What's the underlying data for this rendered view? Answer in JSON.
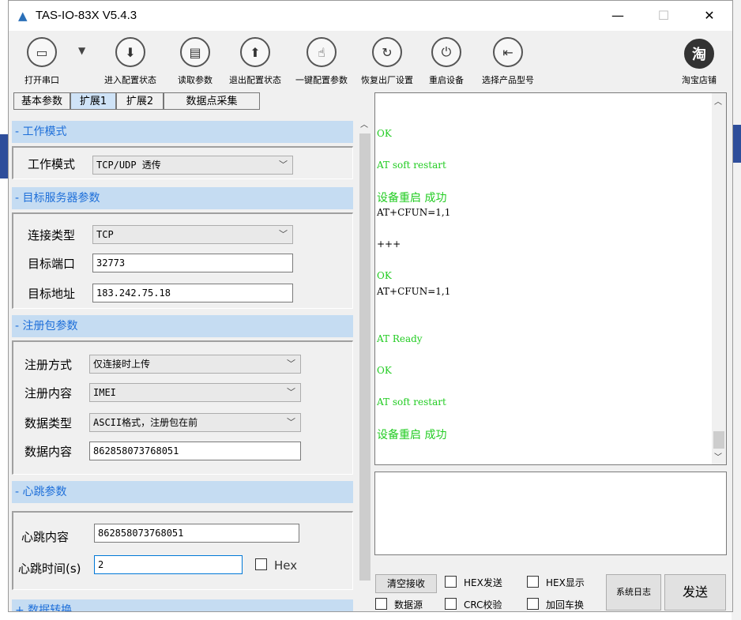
{
  "window": {
    "title": "TAS-IO-83X V5.4.3",
    "minimize": "—",
    "maximize": "☐",
    "close": "✕"
  },
  "toolbar": {
    "open_port": "打开串口",
    "enter_config": "进入配置状态",
    "read_params": "读取参数",
    "exit_config": "退出配置状态",
    "one_key_config": "一键配置参数",
    "factory_reset": "恢复出厂设置",
    "restart": "重启设备",
    "select_model": "选择产品型号",
    "taobao": "淘宝店铺",
    "taobao_glyph": "淘"
  },
  "tabs": [
    "基本参数",
    "扩展1",
    "扩展2",
    "数据点采集"
  ],
  "active_tab": "扩展1",
  "work_mode": {
    "header": "- 工作模式",
    "label": "工作模式",
    "value": "TCP/UDP 透传"
  },
  "target_server": {
    "header": "- 目标服务器参数",
    "conn_type_label": "连接类型",
    "conn_type_value": "TCP",
    "port_label": "目标端口",
    "port_value": "32773",
    "addr_label": "目标地址",
    "addr_value": "183.242.75.18"
  },
  "register": {
    "header": "- 注册包参数",
    "mode_label": "注册方式",
    "mode_value": "仅连接时上传",
    "content_label": "注册内容",
    "content_value": "IMEI",
    "data_type_label": "数据类型",
    "data_type_value": "ASCII格式，注册包在前",
    "data_content_label": "数据内容",
    "data_content_value": "862858073768051"
  },
  "heartbeat": {
    "header": "- 心跳参数",
    "content_label": "心跳内容",
    "content_value": "862858073768051",
    "time_label": "心跳时间(s)",
    "time_value": "2",
    "hex_label": "Hex"
  },
  "next_section": "+ 数据转换",
  "log": {
    "lines": [
      {
        "text": "OK",
        "color": "#22cc22"
      },
      {
        "text": "AT soft restart",
        "color": "#22cc22"
      },
      {
        "text": " 设备重启 成功",
        "color": "#22cc22"
      },
      {
        "text": "AT+CFUN=1,1",
        "color": "#000000"
      },
      {
        "text": "+++",
        "color": "#000000"
      },
      {
        "text": "OK",
        "color": "#22cc22"
      },
      {
        "text": "AT+CFUN=1,1",
        "color": "#000000"
      },
      {
        "text": "AT Ready",
        "color": "#22cc22"
      },
      {
        "text": "OK",
        "color": "#22cc22"
      },
      {
        "text": "AT soft restart",
        "color": "#22cc22"
      },
      {
        "text": "设备重启 成功",
        "color": "#22cc22"
      }
    ]
  },
  "bottom": {
    "clear_recv": "清空接收",
    "hex_send": "HEX发送",
    "hex_show": "HEX显示",
    "sys_log": "系统日志",
    "send": "发送",
    "data_source": "数据源",
    "crc_check": "CRC校验",
    "add_crlf": "加回车换"
  }
}
